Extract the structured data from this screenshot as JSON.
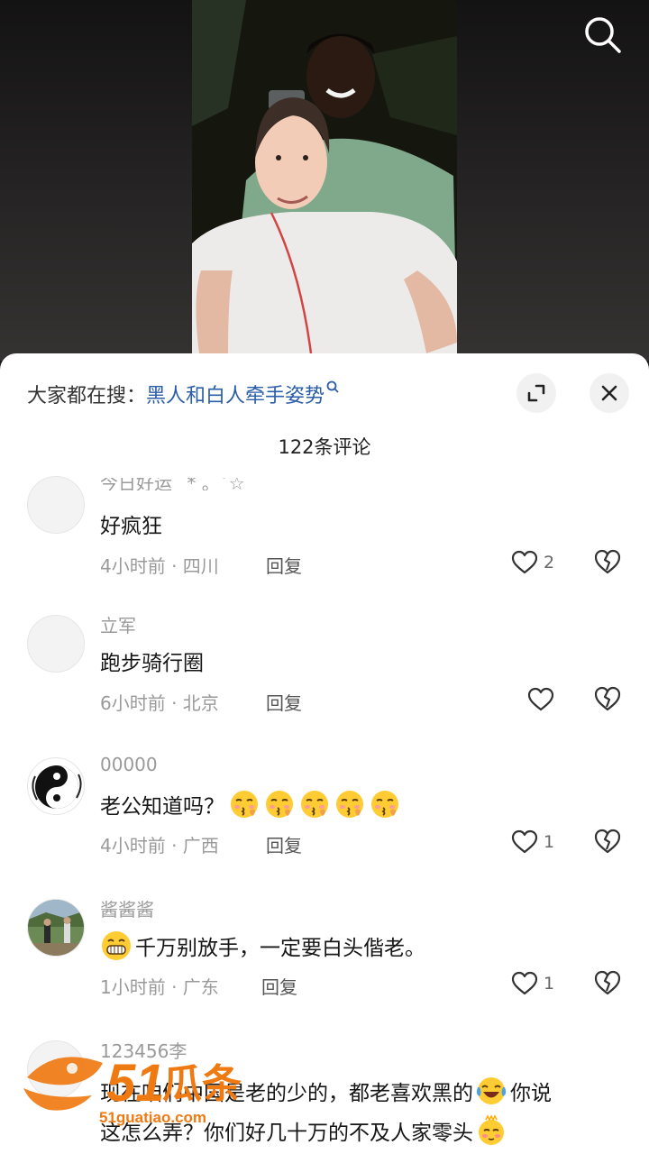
{
  "top_bar": {
    "search_icon": "search-icon"
  },
  "hot_search": {
    "prefix": "大家都在搜：",
    "term": "黑人和白人牵手姿势",
    "expand_icon": "expand-icon",
    "close_icon": "close-icon"
  },
  "comment_count": "122条评论",
  "comments": [
    {
      "username": "今日好运˙ * 。˚☆",
      "text": "好疯狂",
      "time_location": "4小时前 · 四川",
      "reply": "回复",
      "likes": "2"
    },
    {
      "username": "立军",
      "text": "跑步骑行圈",
      "time_location": "6小时前 · 北京",
      "reply": "回复",
      "likes": ""
    },
    {
      "username": "00000",
      "text": "老公知道吗？",
      "time_location": "4小时前 · 广西",
      "reply": "回复",
      "likes": "1",
      "emojis": [
        "kiss-emoji",
        "kiss-emoji",
        "kiss-emoji",
        "kiss-emoji",
        "kiss-emoji"
      ]
    },
    {
      "username": "酱酱酱",
      "text": "千万别放手，一定要白头偕老。",
      "time_location": "1小时前 · 广东",
      "reply": "回复",
      "likes": "1",
      "lead_emoji": "grin-emoji"
    },
    {
      "username": "123456李",
      "text_line1": "现在咱们中国是老的少的，都老喜欢黑的",
      "text_line1_tail": "你说",
      "text_line2": "这怎么弄？你们好几十万的不及人家零头"
    }
  ],
  "watermark": {
    "brand_number": "51",
    "brand_chars": "瓜条",
    "domain": "51guatiao.com"
  },
  "colors": {
    "link_blue": "#2b5ea8",
    "meta_gray": "#9a9a9a",
    "watermark_orange": "#f07a12"
  }
}
